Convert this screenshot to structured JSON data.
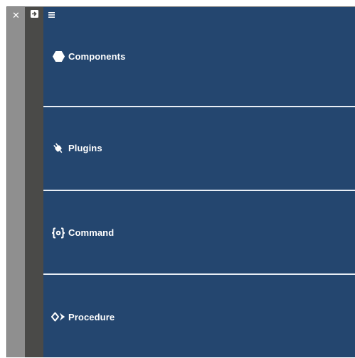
{
  "toolbar": {
    "close_icon": "close-icon",
    "pin_icon": "pin-icon",
    "menu_icon": "hamburger-menu-icon"
  },
  "sections": [
    {
      "label": "Components",
      "icon": "hexagon-icon"
    },
    {
      "label": "Plugins",
      "icon": "plug-icon"
    },
    {
      "label": "Command",
      "icon": "braces-gear-icon"
    },
    {
      "label": "Procedure",
      "icon": "diamond-arrows-icon"
    }
  ],
  "colors": {
    "panel_background": "#24466f",
    "close_column": "#8f8f8f",
    "pin_column": "#4a4a48",
    "divider": "#e8eef5",
    "text": "#ffffff"
  }
}
